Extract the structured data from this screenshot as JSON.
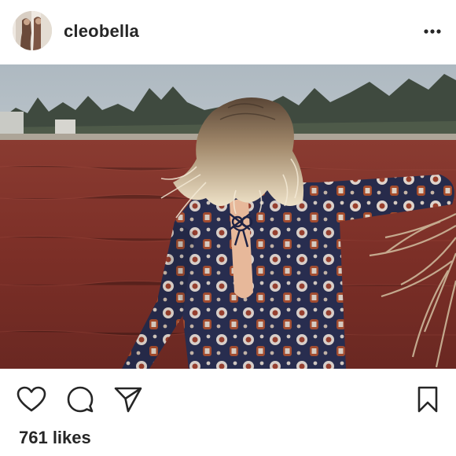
{
  "post": {
    "username": "cleobella",
    "likes_text": "761 likes"
  },
  "icons": {
    "more": "more-options-icon",
    "like": "heart-icon",
    "comment": "comment-icon",
    "share": "share-icon",
    "save": "bookmark-icon"
  },
  "colors": {
    "text": "#262626",
    "field": "#7a2e26",
    "background": "#ffffff"
  }
}
